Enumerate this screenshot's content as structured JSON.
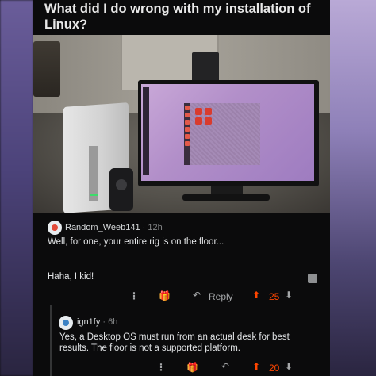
{
  "post": {
    "title": "What did I do wrong with my installation of Linux?"
  },
  "comments": [
    {
      "username": "Random_Weeb141",
      "separator": "·",
      "age": "12h",
      "paragraphs": [
        "Well, for one, your entire rig is on the floor...",
        "Haha, I kid!"
      ],
      "actions": {
        "more_icon": "more-vertical-icon",
        "award_icon": "gift-icon",
        "reply_label": "Reply",
        "upvote_icon": "arrow-up-icon",
        "score": "25",
        "downvote_icon": "arrow-down-icon"
      }
    },
    {
      "username": "ign1fy",
      "separator": "·",
      "age": "6h",
      "paragraphs": [
        "Yes, a Desktop OS must run from an actual desk for best results. The floor is not a supported platform."
      ],
      "actions": {
        "more_icon": "more-vertical-icon",
        "award_icon": "gift-icon",
        "reply_icon": "reply-icon",
        "upvote_icon": "arrow-up-icon",
        "score": "20",
        "downvote_icon": "arrow-down-icon"
      }
    }
  ],
  "colors": {
    "upvote": "#ff4500",
    "background": "#0b0b0c",
    "text": "#e3e5e7"
  }
}
